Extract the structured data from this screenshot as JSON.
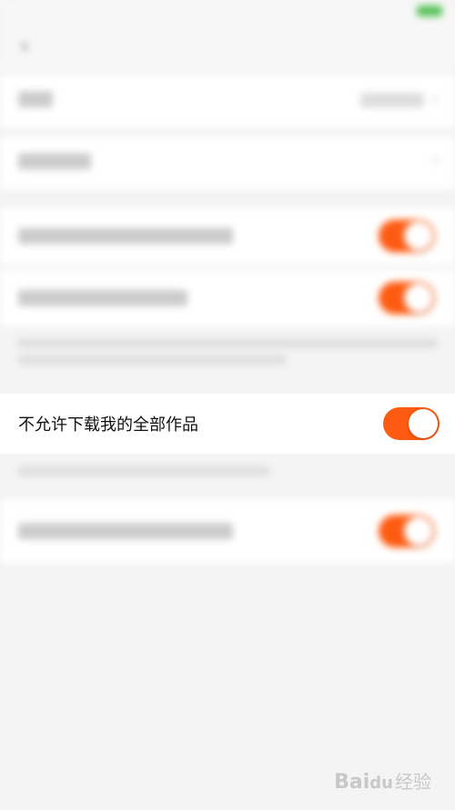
{
  "status_bar": {
    "carrier": "",
    "time": "",
    "battery_color": "#5ac15a"
  },
  "nav": {
    "title": ""
  },
  "focused_setting": {
    "label": "不允许下载我的全部作品",
    "enabled": true,
    "accent_color": "#fe5b12"
  },
  "watermark": {
    "brand": "Bai",
    "paw": "du",
    "suffix": "经验"
  }
}
